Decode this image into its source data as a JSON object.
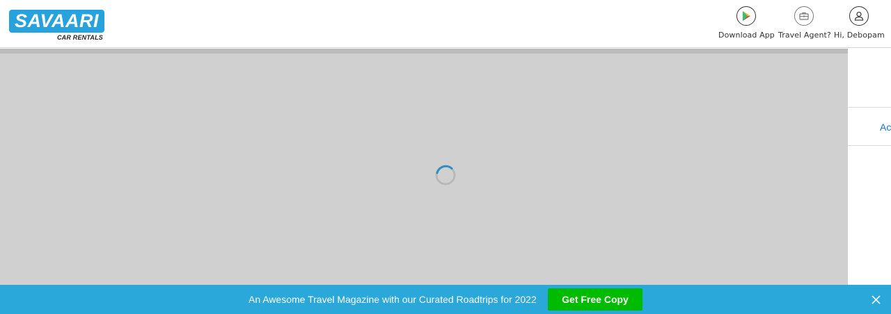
{
  "logo": {
    "name": "SAVAARI",
    "subtitle": "CAR RENTALS"
  },
  "header_nav": [
    {
      "label": "Download App",
      "icon": "play-store-icon"
    },
    {
      "label": "Travel Agent?",
      "icon": "briefcase-icon"
    },
    {
      "label": "Hi, Debopam",
      "icon": "user-icon"
    }
  ],
  "side_panel": {
    "text": "Ac"
  },
  "loading": {
    "icon": "loading-spinner-icon"
  },
  "banner": {
    "text": "An Awesome Travel Magazine with our Curated Roadtrips for 2022",
    "button_label": "Get Free Copy",
    "close_icon": "close-icon"
  },
  "colors": {
    "brand_blue": "#27a2dd",
    "banner_bg": "#2aa8da",
    "cta_green": "#00bb00",
    "overlay_grey": "#d0d0d0",
    "link_blue": "#1a73c8"
  }
}
